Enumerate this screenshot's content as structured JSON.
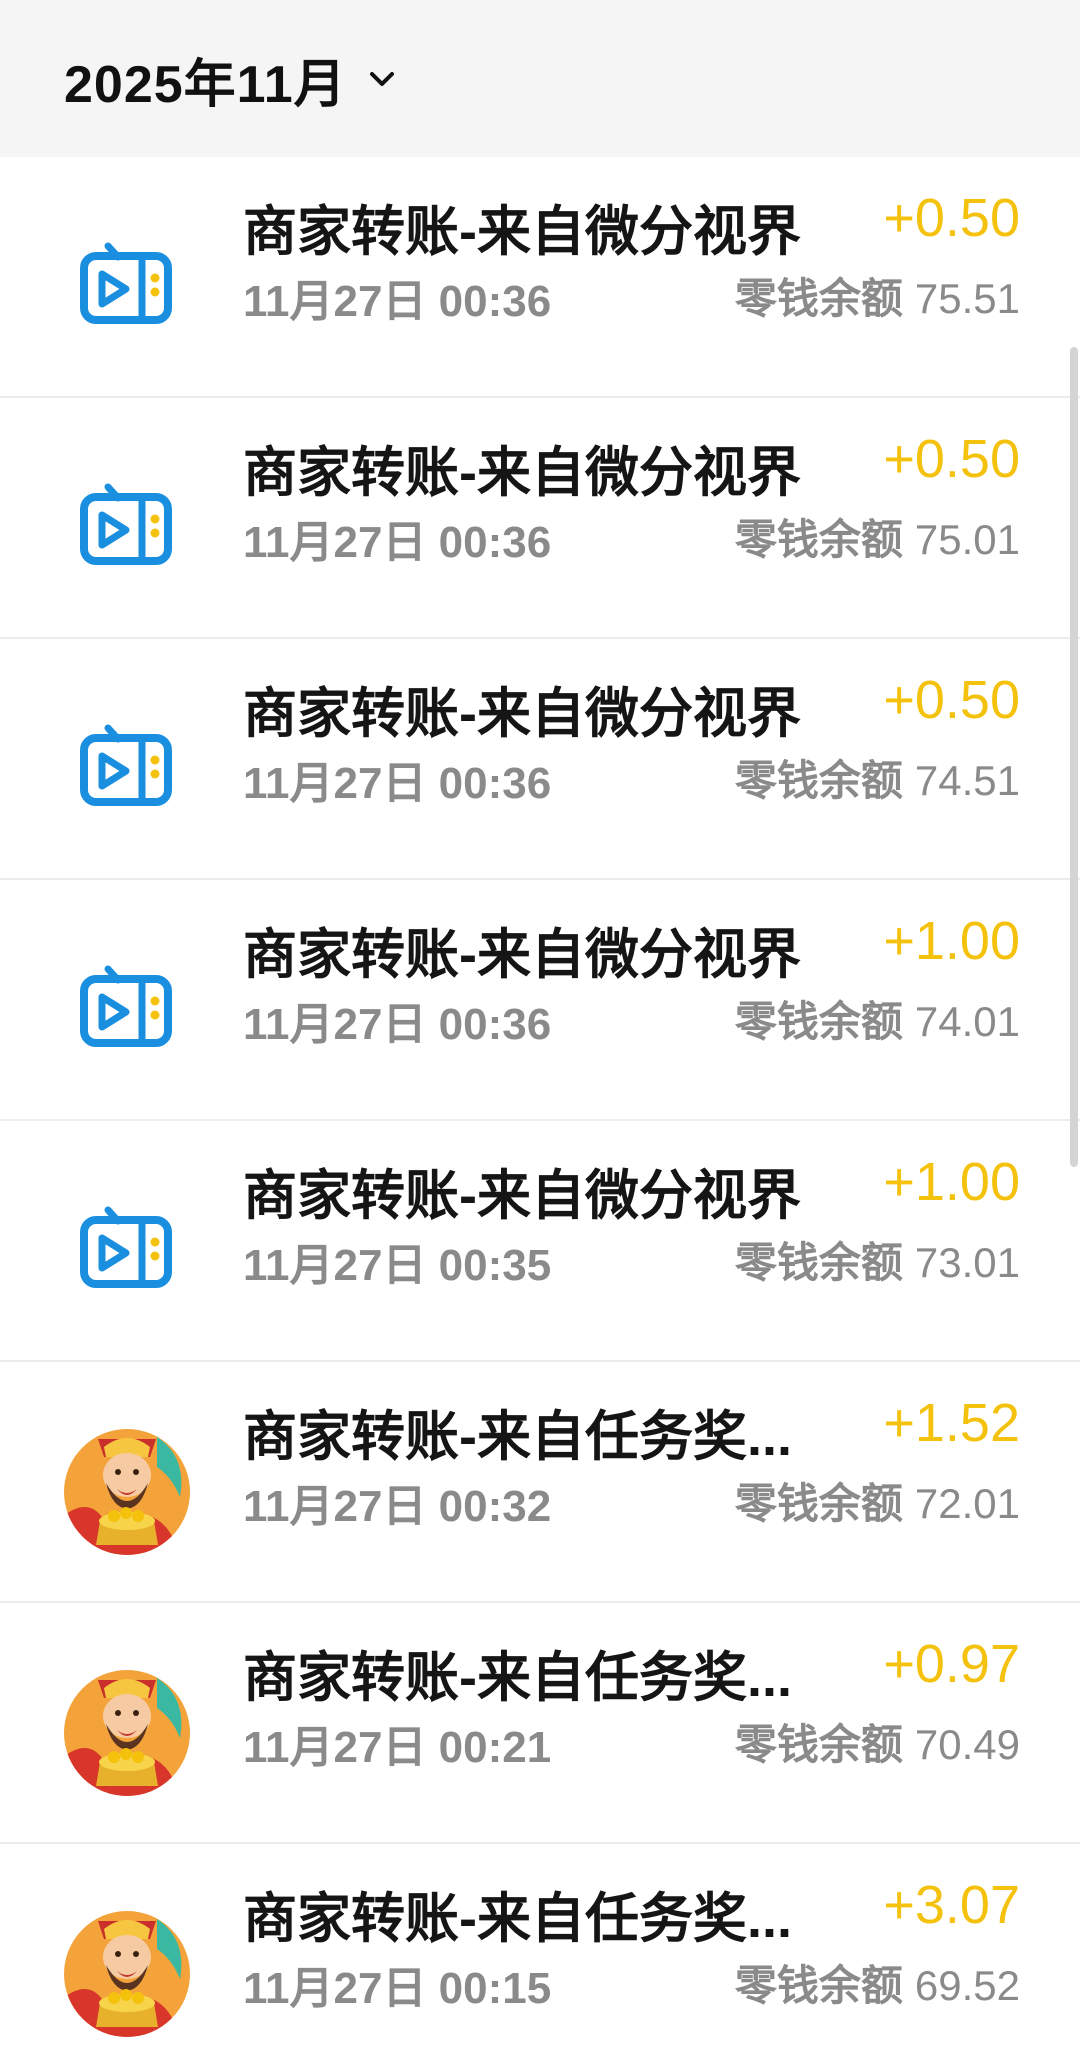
{
  "header": {
    "month": "2025年11月",
    "chevron_icon": "chevron-down-icon"
  },
  "colors": {
    "amount": "#f4c20d",
    "secondary_text": "#8a8a8a",
    "primary_text": "#151515",
    "tv_icon": "#1a8fe0",
    "header_bg": "#f5f5f5"
  },
  "balance_label": "零钱余额",
  "transactions": [
    {
      "title": "商家转账-来自微分视界",
      "time": "11月27日 00:36",
      "amount": "+0.50",
      "balance": "75.51",
      "icon": "tv-app-icon"
    },
    {
      "title": "商家转账-来自微分视界",
      "time": "11月27日 00:36",
      "amount": "+0.50",
      "balance": "75.01",
      "icon": "tv-app-icon"
    },
    {
      "title": "商家转账-来自微分视界",
      "time": "11月27日 00:36",
      "amount": "+0.50",
      "balance": "74.51",
      "icon": "tv-app-icon"
    },
    {
      "title": "商家转账-来自微分视界",
      "time": "11月27日 00:36",
      "amount": "+1.00",
      "balance": "74.01",
      "icon": "tv-app-icon"
    },
    {
      "title": "商家转账-来自微分视界",
      "time": "11月27日 00:35",
      "amount": "+1.00",
      "balance": "73.01",
      "icon": "tv-app-icon"
    },
    {
      "title": "商家转账-来自任务奖...",
      "time": "11月27日 00:32",
      "amount": "+1.52",
      "balance": "72.01",
      "icon": "fortune-god-avatar-icon"
    },
    {
      "title": "商家转账-来自任务奖...",
      "time": "11月27日 00:21",
      "amount": "+0.97",
      "balance": "70.49",
      "icon": "fortune-god-avatar-icon"
    },
    {
      "title": "商家转账-来自任务奖...",
      "time": "11月27日 00:15",
      "amount": "+3.07",
      "balance": "69.52",
      "icon": "fortune-god-avatar-icon"
    }
  ]
}
